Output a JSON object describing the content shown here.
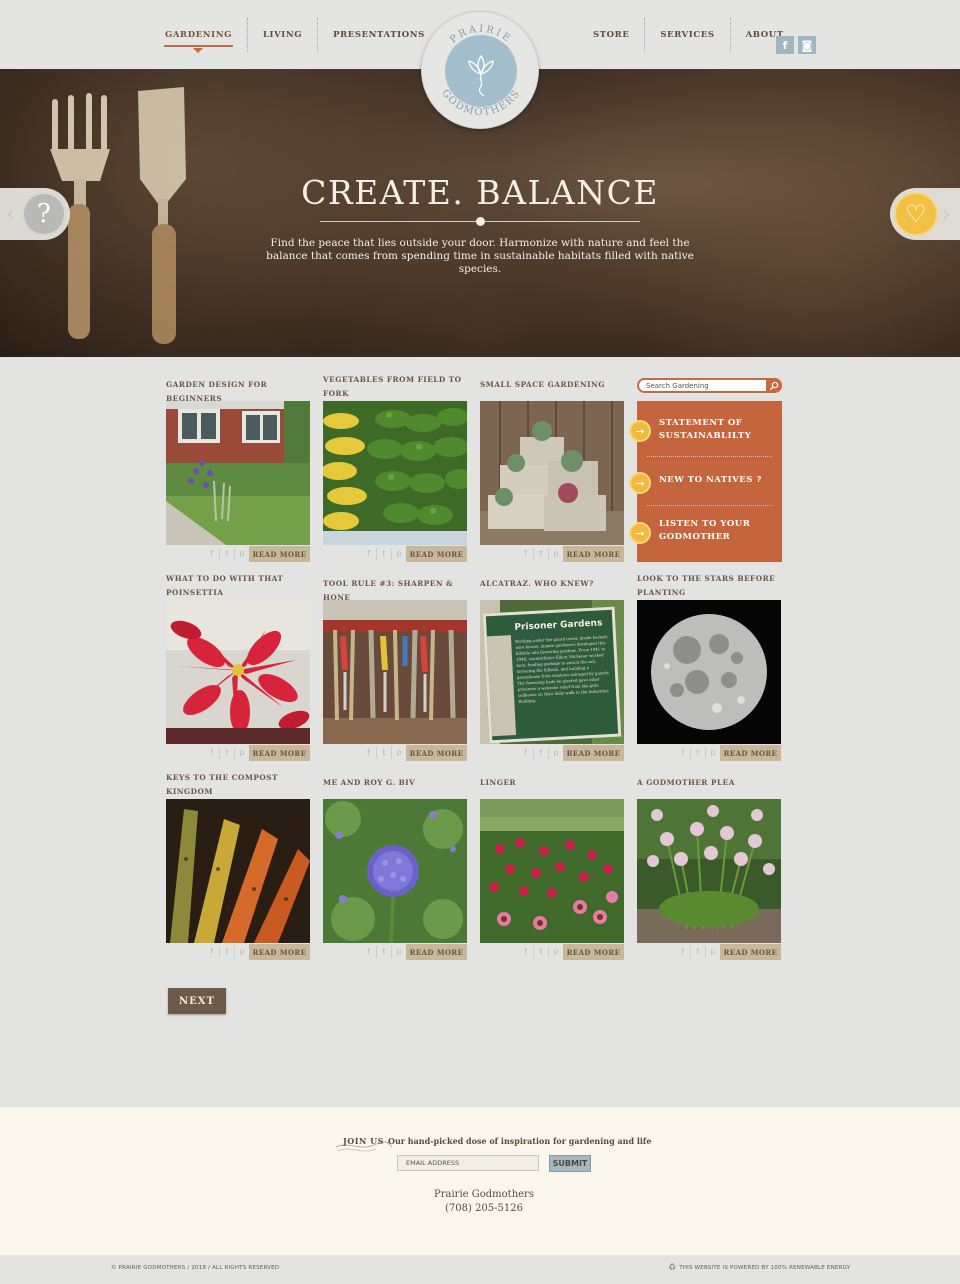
{
  "header": {
    "nav_left": [
      "GARDENING",
      "LIVING",
      "PRESENTATIONS"
    ],
    "nav_right": [
      "STORE",
      "SERVICES",
      "ABOUT"
    ],
    "active": "GARDENING",
    "logo_top": "PRAIRIE",
    "logo_bottom": "GODMOTHERS",
    "social": [
      {
        "icon": "facebook-icon",
        "glyph": "f"
      },
      {
        "icon": "instagram-icon",
        "glyph": "◙"
      }
    ]
  },
  "hero": {
    "title": "CREATE. BALANCE",
    "text": "Find the peace that lies outside your door. Harmonize with nature and feel the balance that comes from spending time in sustainable habitats filled with native species.",
    "prev_icon": "question-icon",
    "prev_glyph": "?",
    "next_icon": "heart-icon",
    "next_glyph": "♡"
  },
  "cards": [
    {
      "title": "GARDEN DESIGN FOR BEGINNERS",
      "read_more": "READ MORE"
    },
    {
      "title": "VEGETABLES FROM FIELD TO FORK",
      "read_more": "READ MORE"
    },
    {
      "title": "SMALL SPACE GARDENING",
      "read_more": "READ MORE"
    },
    {
      "title": "WHAT TO DO WITH THAT POINSETTIA",
      "read_more": "READ MORE"
    },
    {
      "title": "TOOL RULE #3: SHARPEN & HONE",
      "read_more": "READ MORE"
    },
    {
      "title": "ALCATRAZ. WHO KNEW?",
      "read_more": "READ MORE"
    },
    {
      "title": "LOOK TO THE STARS BEFORE PLANTING",
      "read_more": "READ MORE"
    },
    {
      "title": "KEYS TO THE COMPOST KINGDOM",
      "read_more": "READ MORE"
    },
    {
      "title": "ME AND ROY G. BIV",
      "read_more": "READ MORE"
    },
    {
      "title": "LINGER",
      "read_more": "READ MORE"
    },
    {
      "title": "A GODMOTHER PLEA",
      "read_more": "READ MORE"
    }
  ],
  "prisoner_sign": {
    "heading": "Prisoner Gardens",
    "body": "Working under the guard tower, inside barbed-wire fences, inmate gardeners developed this hillside into flowering gardens. From 1941 to 1948, counterfeiter Elliott Michener worked here, hauling garbage to enrich the soil, terracing the hillside, and building a greenhouse from windows salvaged by guards. The flowering beds he planted gave other prisoners a welcome relief from the grim cellhouse on their daily walk to the Industries Building."
  },
  "share_icons": [
    "facebook-icon",
    "twitter-icon",
    "pinterest-icon"
  ],
  "share_glyphs": [
    "f",
    "t",
    "p"
  ],
  "sidebar": {
    "search_placeholder": "Search Gardening",
    "items": [
      "STATEMENT OF SUSTAINABLILTY",
      "NEW TO NATIVES ?",
      "LISTEN TO YOUR GODMOTHER"
    ]
  },
  "pagination": {
    "next_label": "NEXT"
  },
  "footer": {
    "join_label": "JOIN US",
    "join_text": "Our hand-picked dose of inspiration for gardening and life",
    "email_placeholder": "EMAIL ADDRESS",
    "submit_label": "SUBMIT",
    "org_name": "Prairie Godmothers",
    "org_phone": "(708) 205-5126",
    "copyright": "© PRAIRIE GODMOTHERS / 2018 / ALL RIGHTS RESERVED",
    "energy": "THIS WEBSITE IS POWERED BY 100% RENEWABLE ENERGY"
  },
  "colors": {
    "accent": "#c9693f",
    "panel": "#c5653d",
    "bullet": "#f2b93c",
    "read_more": "#c7b79b",
    "next": "#6e5a49",
    "logo_blue": "#a3bfcc"
  }
}
